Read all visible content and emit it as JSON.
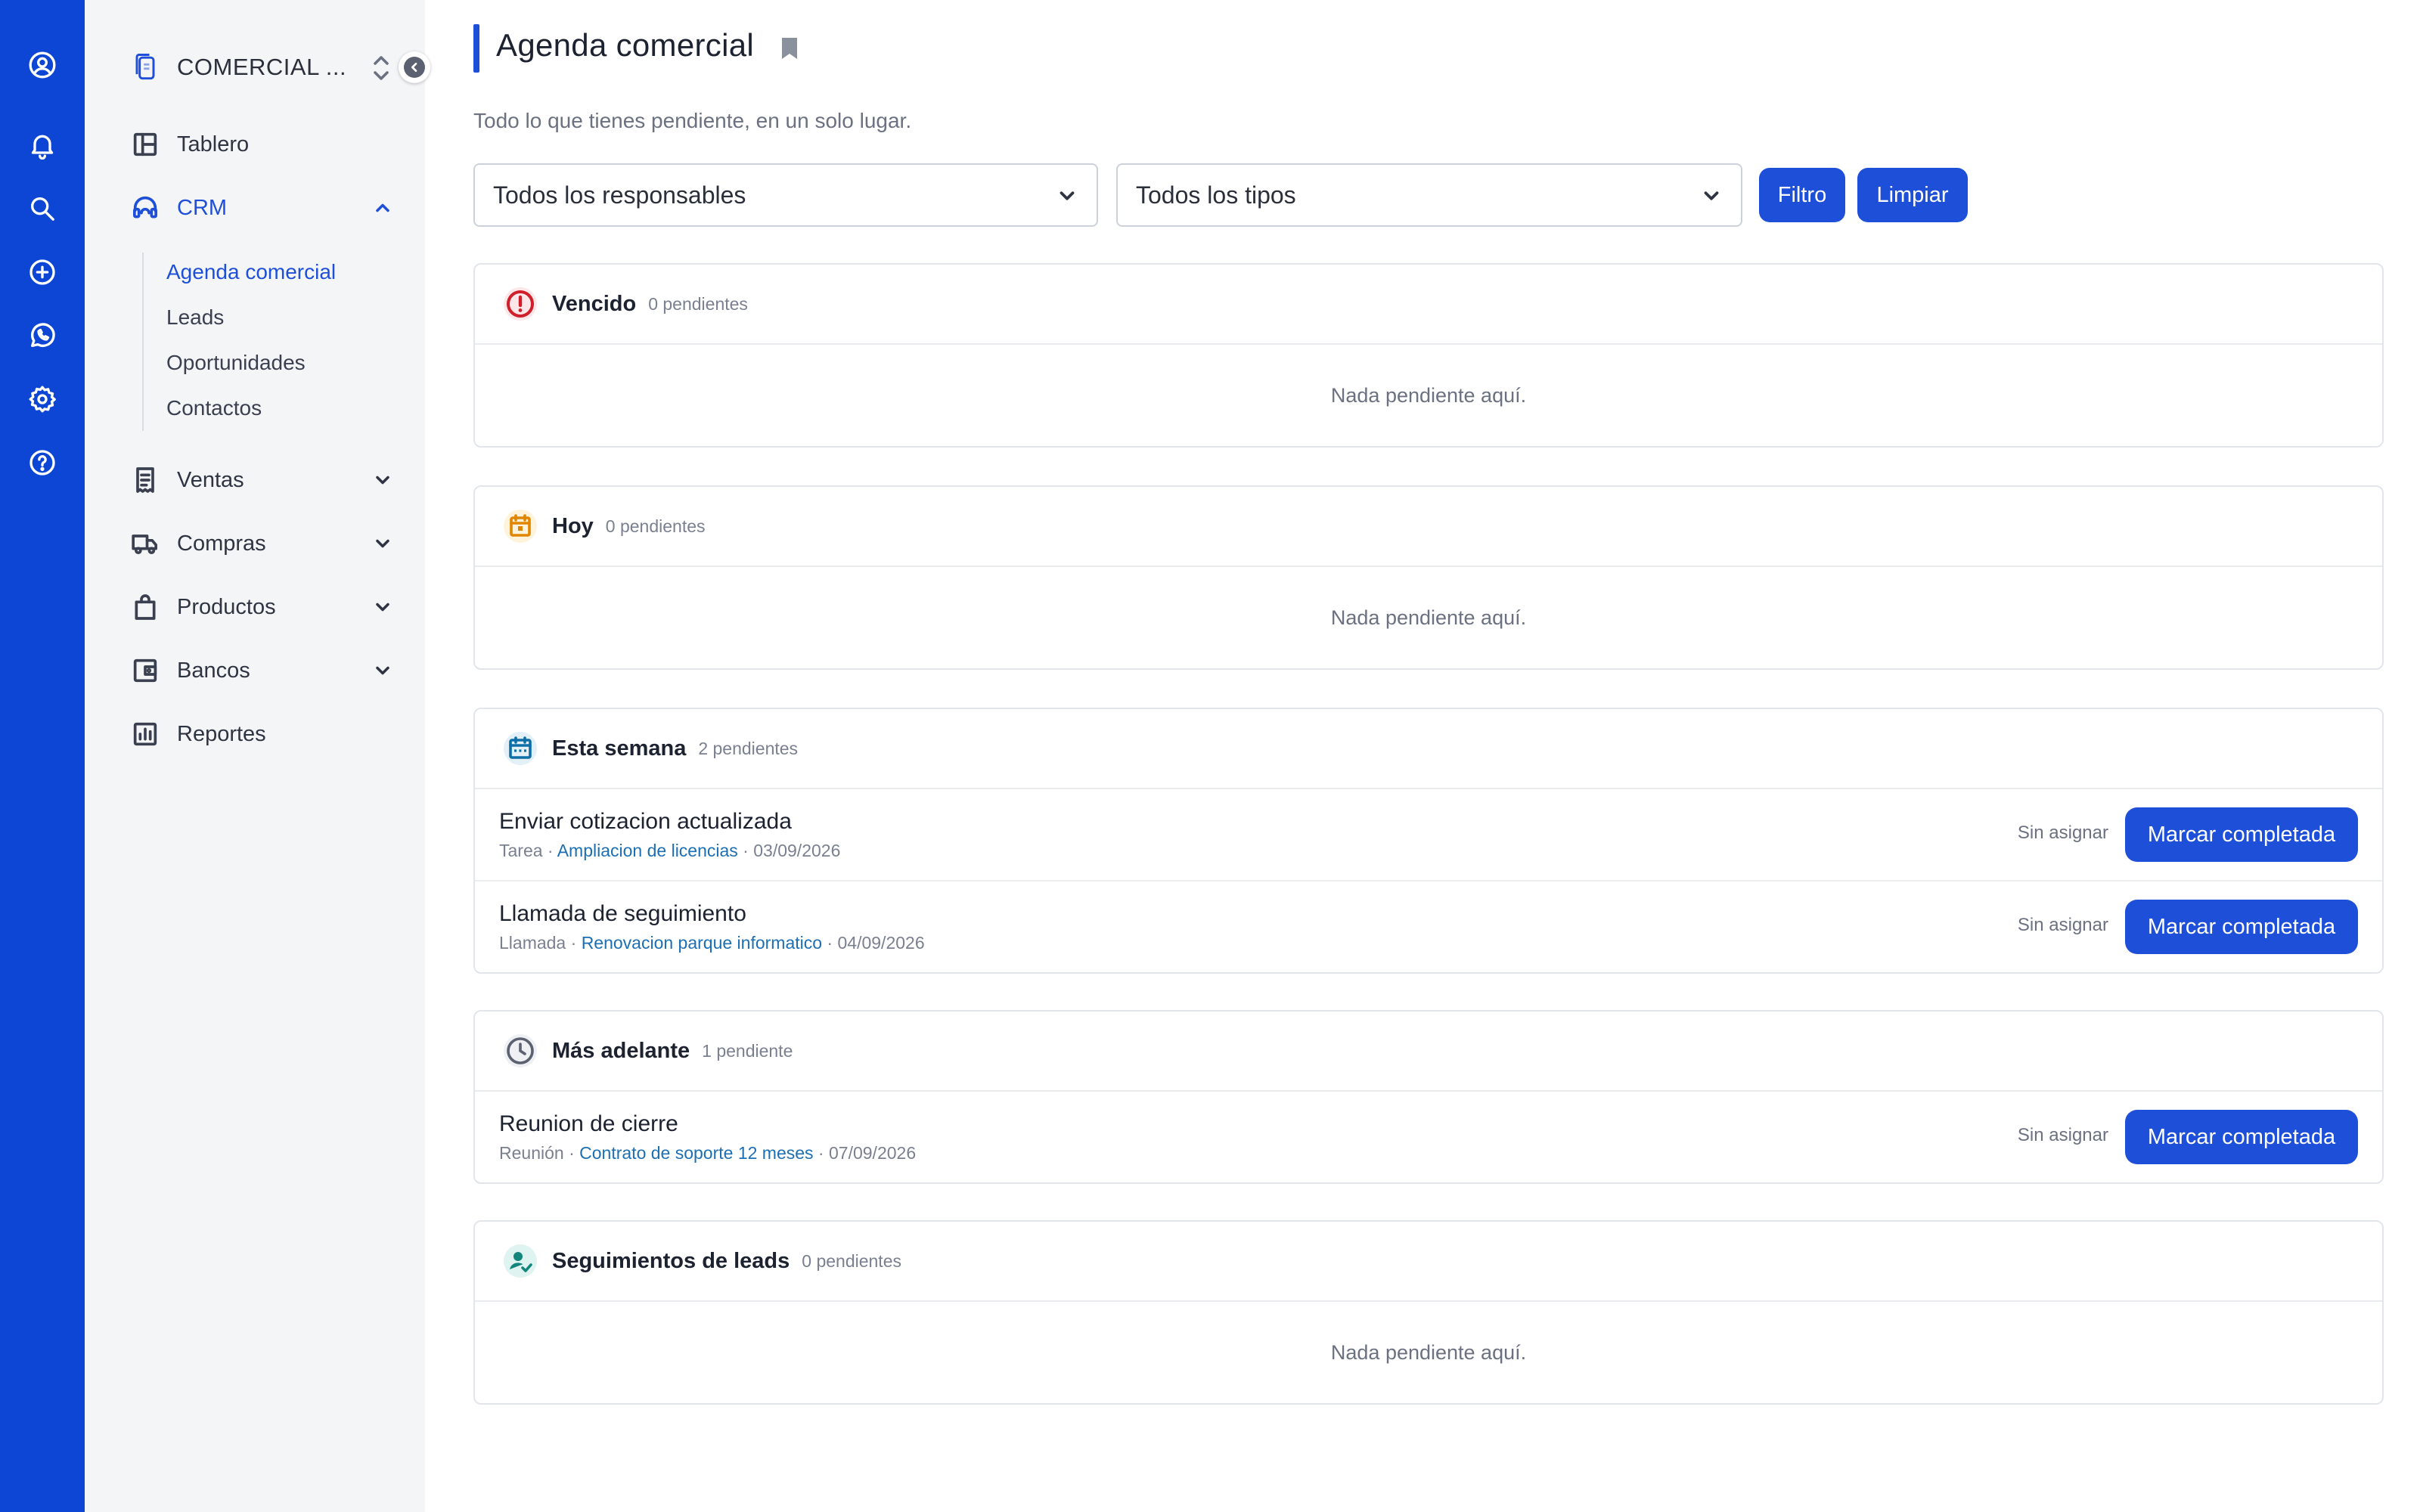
{
  "colors": {
    "rail": "#0d45d4",
    "accent": "#1e4fd8",
    "danger": "#d01f2a",
    "warning": "#f39c12",
    "info": "#0d6ea8",
    "teal": "#14857a"
  },
  "rail": {
    "icons": [
      "user-circle-icon",
      "bell-icon",
      "search-icon",
      "plus-circle-icon",
      "whatsapp-icon",
      "settings-icon",
      "help-icon"
    ]
  },
  "sidebar": {
    "workspace": "COMERCIAL ...",
    "items": [
      {
        "label": "Tablero",
        "icon": "dashboard-icon"
      },
      {
        "label": "CRM",
        "icon": "headset-icon",
        "expanded": true
      },
      {
        "label": "Ventas",
        "icon": "receipt-icon"
      },
      {
        "label": "Compras",
        "icon": "truck-icon"
      },
      {
        "label": "Productos",
        "icon": "shopping-bag-icon"
      },
      {
        "label": "Bancos",
        "icon": "wallet-icon"
      },
      {
        "label": "Reportes",
        "icon": "report-chart-icon"
      }
    ],
    "crm_sub": [
      "Agenda comercial",
      "Leads",
      "Oportunidades",
      "Contactos"
    ]
  },
  "main": {
    "title": "Agenda comercial",
    "subtitle": "Todo lo que tienes pendiente, en un solo lugar.",
    "filters": {
      "responsables": "Todos los responsables",
      "tipos": "Todos los tipos",
      "filter_btn": "Filtro",
      "clear_btn": "Limpiar"
    },
    "empty_text": "Nada pendiente aquí.",
    "assignee_label": "Sin asignar",
    "complete_label": "Marcar completada",
    "sections": [
      {
        "title": "Vencido",
        "count": "0 pendientes"
      },
      {
        "title": "Hoy",
        "count": "0 pendientes"
      },
      {
        "title": "Esta semana",
        "count": "2 pendientes",
        "tasks": [
          {
            "title": "Enviar cotizacion actualizada",
            "type": "Tarea",
            "link": "Ampliacion de licencias",
            "date": "03/09/2026"
          },
          {
            "title": "Llamada de seguimiento",
            "type": "Llamada",
            "link": "Renovacion parque informatico",
            "date": "04/09/2026"
          }
        ]
      },
      {
        "title": "Más adelante",
        "count": "1 pendiente",
        "tasks": [
          {
            "title": "Reunion de cierre",
            "type": "Reunión",
            "link": "Contrato de soporte 12 meses",
            "date": "07/09/2026"
          }
        ]
      },
      {
        "title": "Seguimientos de leads",
        "count": "0 pendientes"
      }
    ]
  }
}
